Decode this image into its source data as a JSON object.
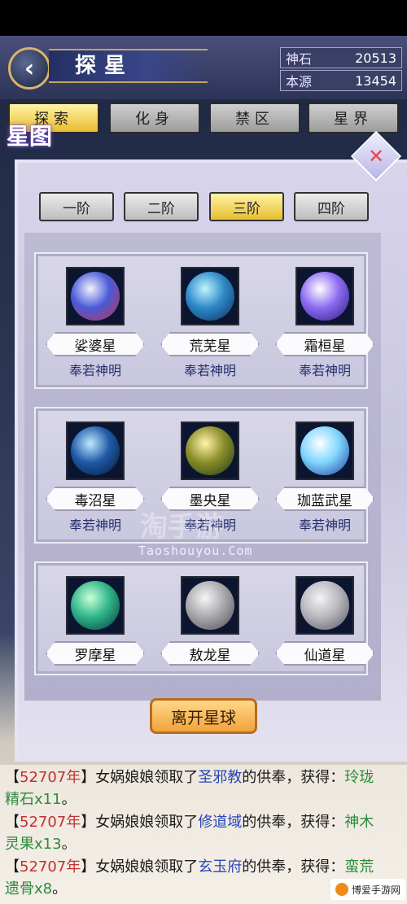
{
  "header": {
    "title": "探星",
    "resources": [
      {
        "label": "神石",
        "value": "20513"
      },
      {
        "label": "本源",
        "value": "13454"
      }
    ]
  },
  "tabs": [
    "探索",
    "化身",
    "禁区",
    "星界"
  ],
  "panel": {
    "star_label": "星图",
    "tiers": [
      "一阶",
      "二阶",
      "三阶",
      "四阶"
    ],
    "groups": [
      [
        {
          "name": "娑婆星",
          "sub": "奉若神明",
          "colors": [
            "#f1f1ff",
            "#4a5ad8",
            "#c0334b"
          ]
        },
        {
          "name": "荒芜星",
          "sub": "奉若神明",
          "colors": [
            "#bff6ff",
            "#2d89c9",
            "#0d2d58"
          ]
        },
        {
          "name": "霜桓星",
          "sub": "奉若神明",
          "colors": [
            "#ffffff",
            "#8c6bf1",
            "#2a1a7c"
          ]
        }
      ],
      [
        {
          "name": "毒沼星",
          "sub": "奉若神明",
          "colors": [
            "#bfe9ff",
            "#1f5aa8",
            "#07162e"
          ]
        },
        {
          "name": "墨央星",
          "sub": "奉若神明",
          "colors": [
            "#fff4a6",
            "#8a8c2a",
            "#1b3b16"
          ]
        },
        {
          "name": "珈蓝武星",
          "sub": "奉若神明",
          "colors": [
            "#ffffff",
            "#7fd5ff",
            "#1d3a9a"
          ]
        }
      ],
      [
        {
          "name": "罗摩星",
          "sub": "",
          "colors": [
            "#caffd8",
            "#2fb58a",
            "#07343a"
          ]
        },
        {
          "name": "敖龙星",
          "sub": "",
          "colors": [
            "#f6f6f6",
            "#a9a9ad",
            "#4a4a52"
          ]
        },
        {
          "name": "仙道星",
          "sub": "",
          "colors": [
            "#f4f4f6",
            "#b7b7bd",
            "#55555d"
          ]
        }
      ]
    ],
    "leave_button": "离开星球"
  },
  "watermark": {
    "text": "淘手游",
    "url": "Taoshouyou.Com"
  },
  "log": [
    {
      "year": "52707年",
      "pre": "女娲娘娘领取了",
      "place": "圣邪教",
      "mid": "的供奉，获得：",
      "item1": "玲珑",
      "item2": "精石x11",
      "end": "。"
    },
    {
      "year": "52707年",
      "pre": "女娲娘娘领取了",
      "place": "修道域",
      "mid": "的供奉，获得：",
      "item1": "神木",
      "item2": "灵果x13",
      "end": "。"
    },
    {
      "year": "52707年",
      "pre": "女娲娘娘领取了",
      "place": "玄玉府",
      "mid": "的供奉，获得：",
      "item1": "蛮荒",
      "item2": "遗骨x8",
      "end": "。"
    }
  ],
  "brand": "博爱手游网"
}
